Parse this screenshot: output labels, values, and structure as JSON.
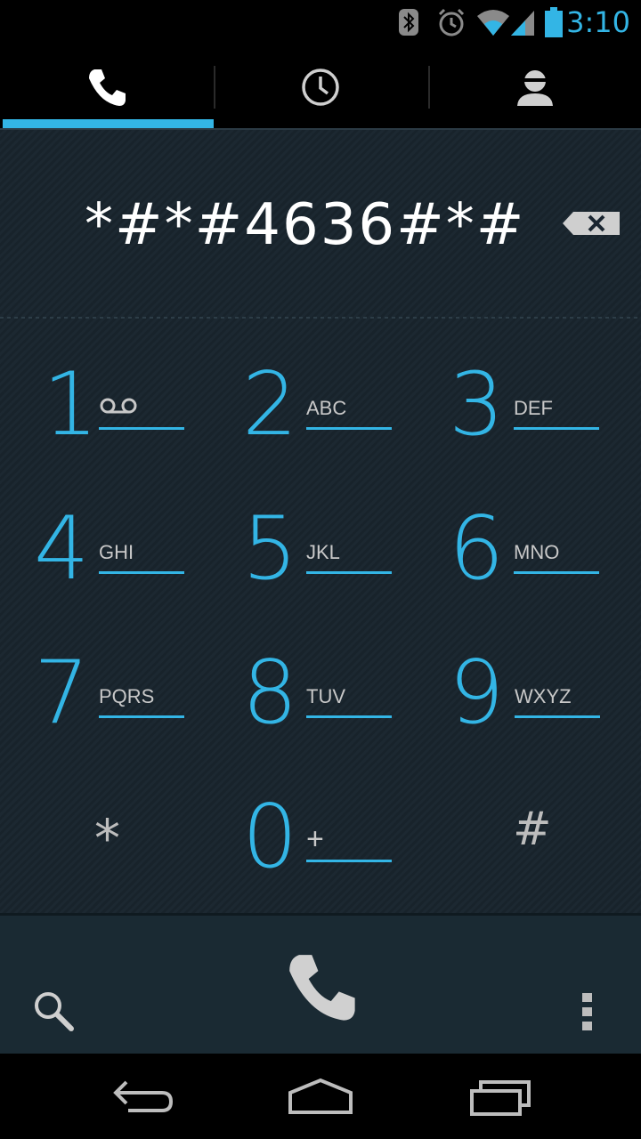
{
  "status_bar": {
    "time": "3:10",
    "icons": [
      "bluetooth-icon",
      "alarm-icon",
      "wifi-icon",
      "signal-icon",
      "battery-icon"
    ],
    "accent": "#33b5e5"
  },
  "tabs": [
    {
      "name": "phone",
      "icon": "phone-icon",
      "selected": true
    },
    {
      "name": "call-log",
      "icon": "clock-icon",
      "selected": false
    },
    {
      "name": "contacts",
      "icon": "contact-icon",
      "selected": false
    }
  ],
  "dialer": {
    "digits": "*#*#4636#*#"
  },
  "keypad": [
    {
      "digit": "1",
      "letters": ""
    },
    {
      "digit": "2",
      "letters": "ABC"
    },
    {
      "digit": "3",
      "letters": "DEF"
    },
    {
      "digit": "4",
      "letters": "GHI"
    },
    {
      "digit": "5",
      "letters": "JKL"
    },
    {
      "digit": "6",
      "letters": "MNO"
    },
    {
      "digit": "7",
      "letters": "PQRS"
    },
    {
      "digit": "8",
      "letters": "TUV"
    },
    {
      "digit": "9",
      "letters": "WXYZ"
    },
    {
      "digit": "*",
      "letters": ""
    },
    {
      "digit": "0",
      "letters": "+"
    },
    {
      "digit": "#",
      "letters": ""
    }
  ],
  "colors": {
    "accent": "#33b5e5",
    "background": "#1b262e"
  }
}
